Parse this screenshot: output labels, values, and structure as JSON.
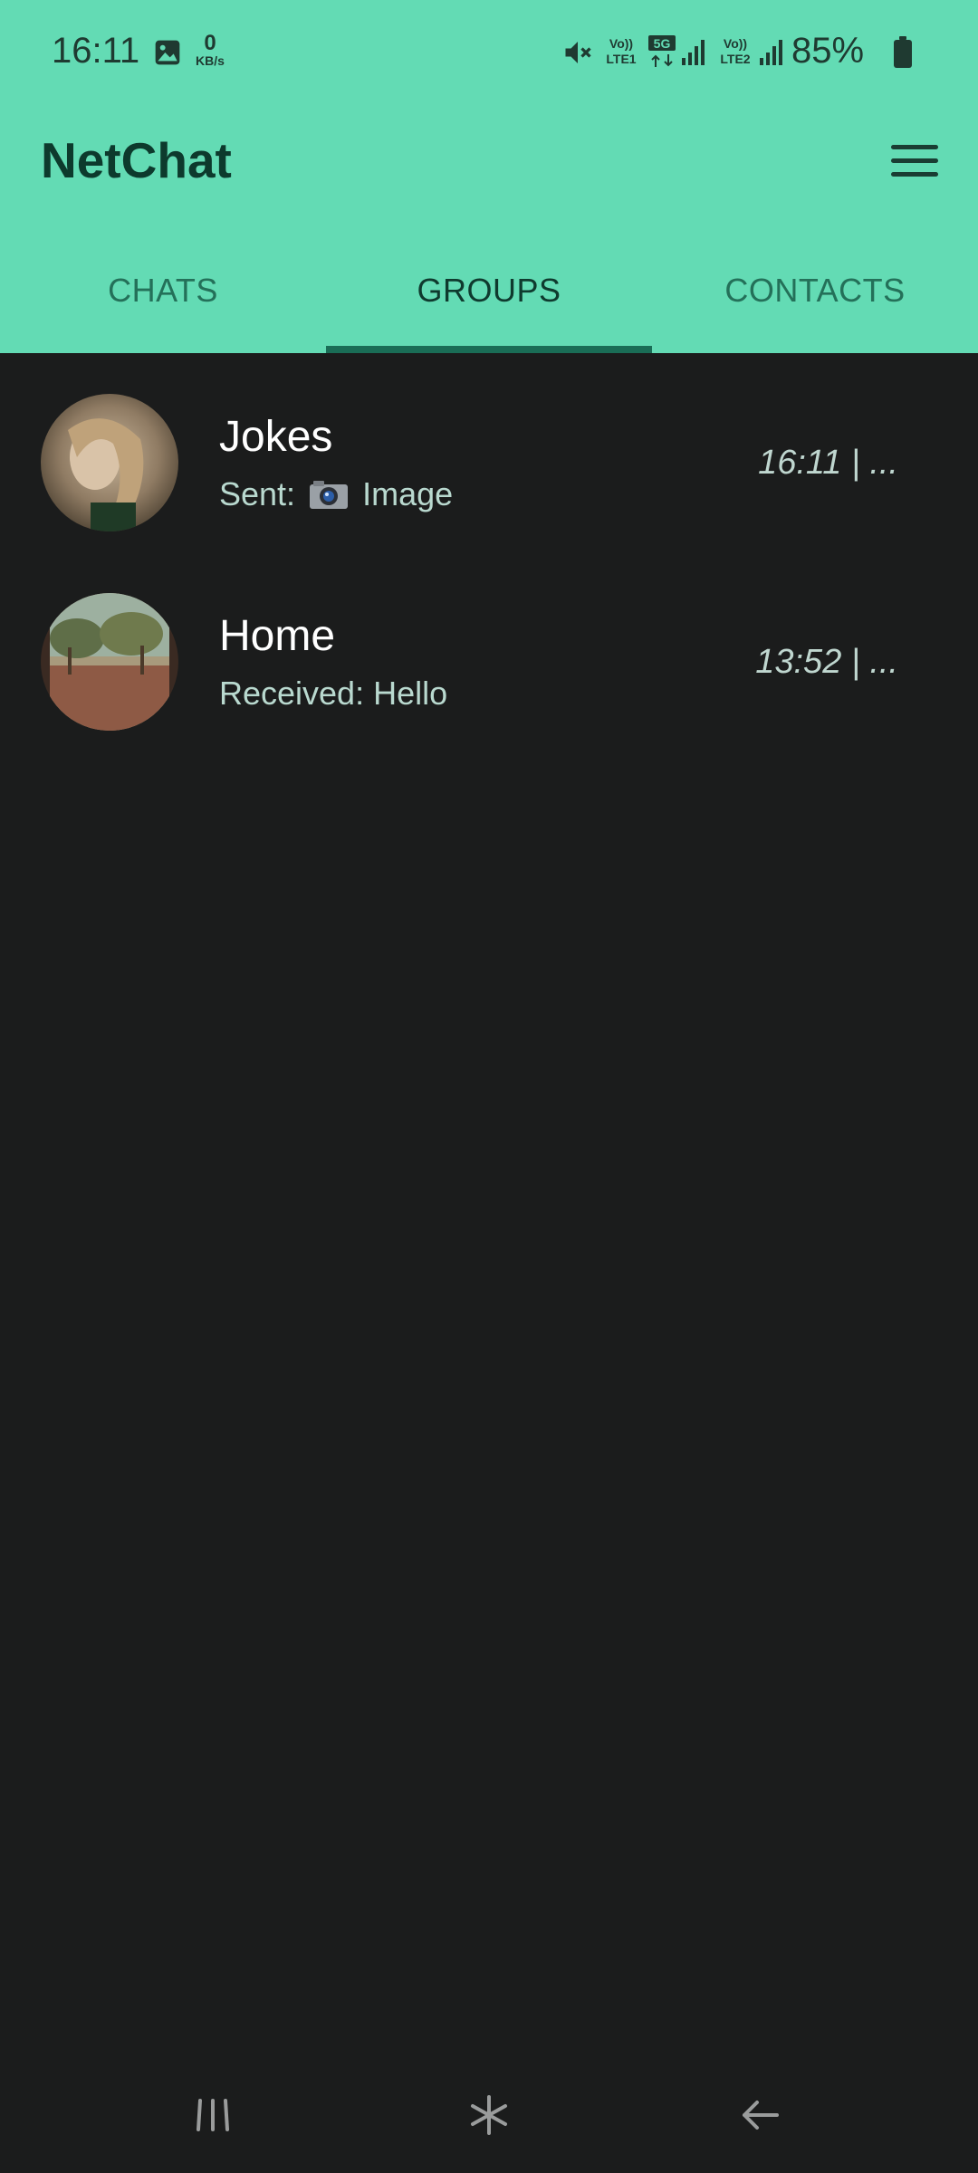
{
  "status_bar": {
    "time": "16:11",
    "net_speed_value": "0",
    "net_speed_unit": "KB/s",
    "volte1_top": "Vo))",
    "volte1_bottom": "LTE1",
    "network_5g": "5G",
    "volte2_top": "Vo))",
    "volte2_bottom": "LTE2",
    "battery": "85%"
  },
  "app_bar": {
    "title": "NetChat",
    "menu_icon": "hamburger-menu-icon"
  },
  "tabs": [
    {
      "label": "CHATS",
      "active": false
    },
    {
      "label": "GROUPS",
      "active": true
    },
    {
      "label": "CONTACTS",
      "active": false
    }
  ],
  "groups": [
    {
      "name": "Jokes",
      "message_prefix": "Sent:",
      "message_text": "Image",
      "message_icon": "camera-icon",
      "time": "16:11 | ..."
    },
    {
      "name": "Home",
      "message": "Received: Hello",
      "time": "13:52 | ..."
    }
  ],
  "nav_bar": {
    "recents": "recents-icon",
    "home": "home-icon",
    "back": "back-icon"
  },
  "colors": {
    "header": "#63dbb4",
    "background": "#1b1c1c",
    "tab_indicator": "#1a6d56",
    "title": "#0d3a2d"
  }
}
